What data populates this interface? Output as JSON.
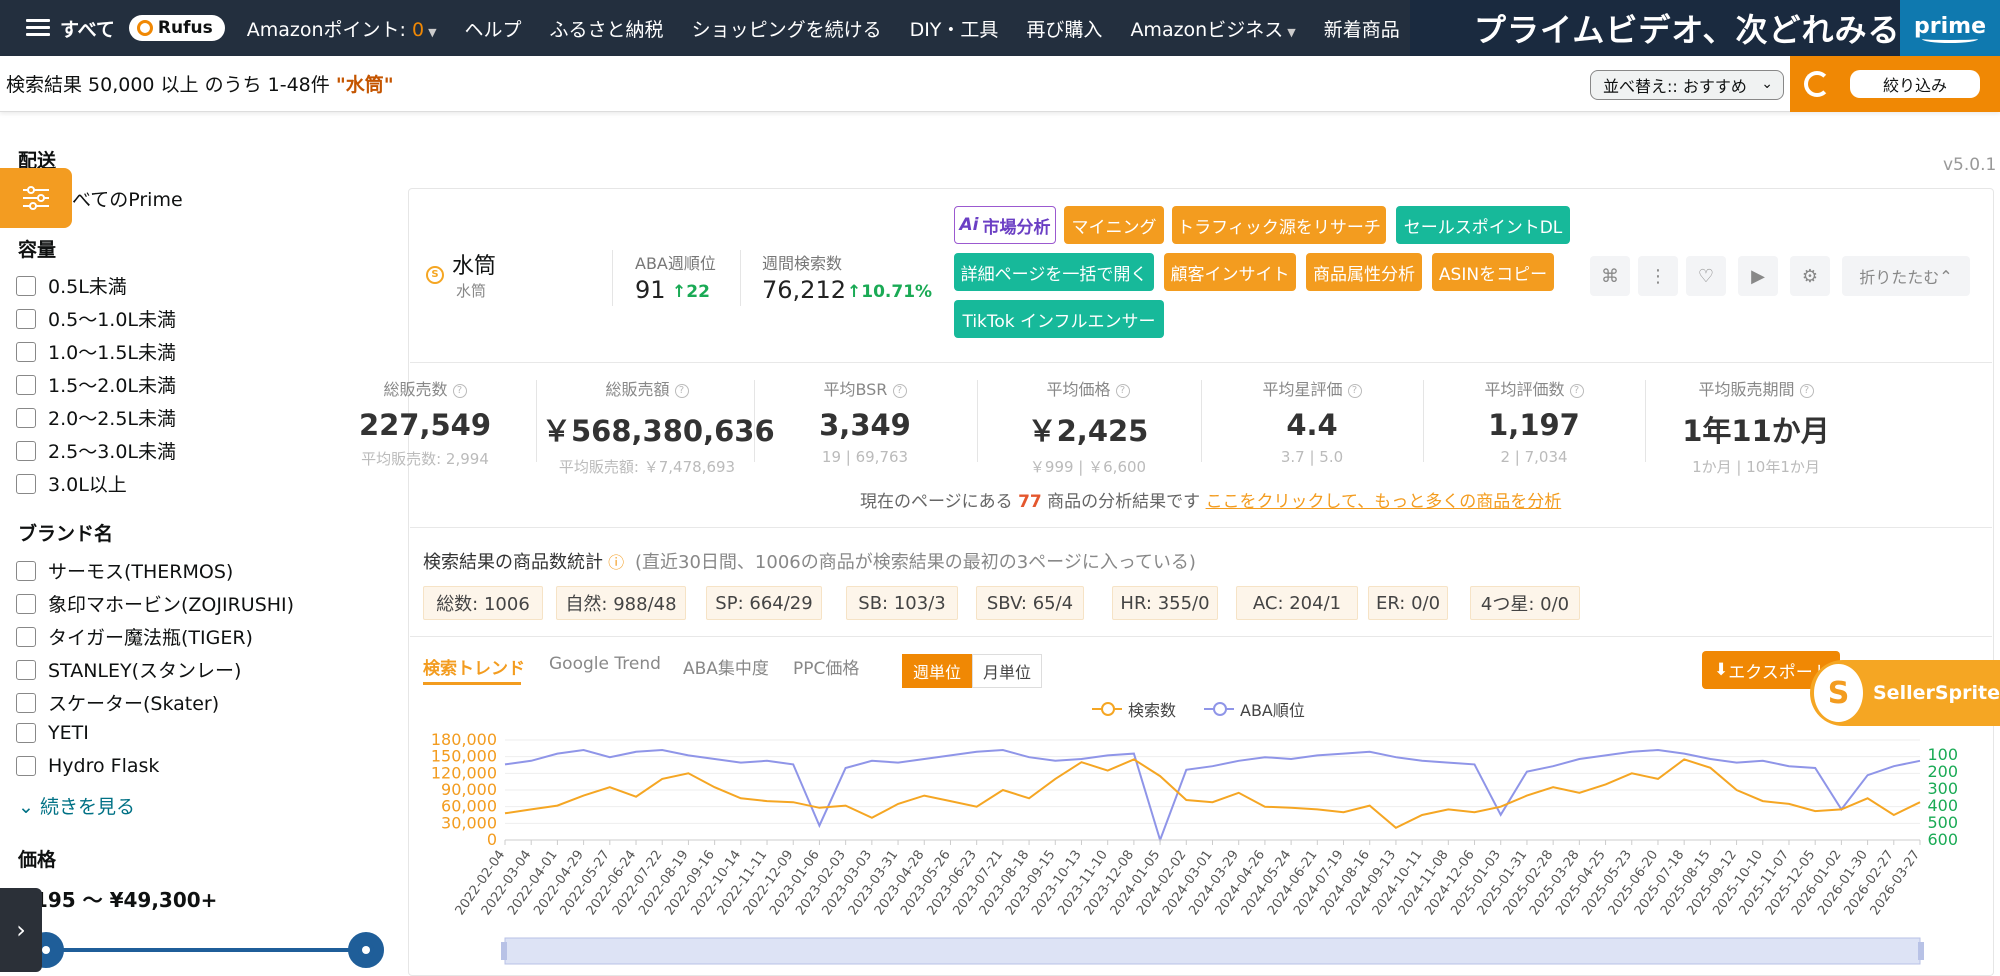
{
  "nav": {
    "all_label": "すべて",
    "rufus_label": "Rufus",
    "points_label": "Amazonポイント: ",
    "points_value": "0",
    "help": "ヘルプ",
    "furusato": "ふるさと納税",
    "continue_shopping": "ショッピングを続ける",
    "diy": "DIY・工具",
    "buy_again": "再び購入",
    "business": "Amazonビジネス",
    "new_arrivals": "新着商品",
    "banner_text": "プライムビデオ、次どれみる？",
    "banner_logo": "prime"
  },
  "results": {
    "summary": "検索結果 50,000 以上 のうち 1-48件 ",
    "query": "\"水筒\"",
    "sort_label": "並べ替え:: おすすめ",
    "filter_button": "絞り込み"
  },
  "sidebar": {
    "delivery_heading": "配送",
    "prime_label": "べてのPrime",
    "capacity_heading": "容量",
    "capacity_options": [
      "0.5L未満",
      "0.5〜1.0L未満",
      "1.0〜1.5L未満",
      "1.5〜2.0L未満",
      "2.0〜2.5L未満",
      "2.5〜3.0L未満",
      "3.0L以上"
    ],
    "brand_heading": "ブランド名",
    "brand_options": [
      "サーモス(THERMOS)",
      "象印マホービン(ZOJIRUSHI)",
      "タイガー魔法瓶(TIGER)",
      "STANLEY(スタンレー)",
      "スケーター(Skater)",
      "YETI",
      "Hydro Flask"
    ],
    "see_more": "続きを見る",
    "price_heading": "価格",
    "price_range": "¥195 〜 ¥49,300+"
  },
  "panel": {
    "version": "v5.0.1",
    "keyword": "水筒",
    "keyword_sub": "水筒",
    "aba_rank_label": "ABA週順位",
    "aba_rank_value": "91",
    "aba_rank_change": "↑22",
    "weekly_search_label": "週間検索数",
    "weekly_search_value": "76,212",
    "weekly_search_change": "↑10.71%",
    "buttons": {
      "ai_market": "市場分析",
      "mining": "マイニング",
      "traffic": "トラフィック源をリサーチ",
      "selling_points": "セールスポイントDL",
      "open_details": "詳細ページを一括で開く",
      "insight": "顧客インサイト",
      "attributes": "商品属性分析",
      "copy_asin": "ASINをコピー",
      "tiktok": "TikTok インフルエンサー",
      "collapse": "折りたたむ"
    },
    "metrics": [
      {
        "label": "総販売数",
        "value": "227,549",
        "sub": "平均販売数: 2,994"
      },
      {
        "label": "総販売額",
        "value": "￥568,380,636",
        "sub": "平均販売額: ￥7,478,693"
      },
      {
        "label": "平均BSR",
        "value": "3,349",
        "sub": "19 | 69,763"
      },
      {
        "label": "平均価格",
        "value": "￥2,425",
        "sub": "￥999 | ￥6,600"
      },
      {
        "label": "平均星評価",
        "value": "4.4",
        "sub": "3.7 | 5.0"
      },
      {
        "label": "平均評価数",
        "value": "1,197",
        "sub": "2 | 7,034"
      },
      {
        "label": "平均販売期間",
        "value": "1年11か月",
        "sub": "1か月 | 10年1か月"
      }
    ],
    "analysis_prefix": "現在のページにある ",
    "analysis_count": "77",
    "analysis_suffix": " 商品の分析結果です ",
    "analysis_link": "ここをクリックして、もっと多くの商品を分析",
    "count_title": "検索結果の商品数統計",
    "count_note": "(直近30日間、1006の商品が検索結果の最初の3ページに入っている)",
    "chips": [
      "総数: 1006",
      "自然: 988/48",
      "SP: 664/29",
      "SB: 103/3",
      "SBV: 65/4",
      "HR: 355/0",
      "AC: 204/1",
      "ER: 0/0",
      "4つ星: 0/0"
    ],
    "tabs": [
      "検索トレンド",
      "Google Trend",
      "ABA集中度",
      "PPC価格"
    ],
    "weekly": "週単位",
    "monthly": "月単位",
    "export": "エクスポート",
    "sellersprite": "SellerSprite"
  },
  "chart_data": {
    "type": "line",
    "title": "",
    "legend": [
      "検索数",
      "ABA順位"
    ],
    "legend_placement": "top-center",
    "colors": {
      "search": "#f5a623",
      "rank": "#8f95e8"
    },
    "y_left_ticks": [
      "180,000",
      "150,000",
      "120,000",
      "90,000",
      "60,000",
      "30,000",
      "0"
    ],
    "y_left_range": [
      0,
      180000
    ],
    "y_right_ticks": [
      "100",
      "200",
      "300",
      "400",
      "500",
      "600"
    ],
    "y_right_range": [
      100,
      600
    ],
    "x_ticks": [
      "2022-02-04",
      "2022-03-04",
      "2022-04-01",
      "2022-04-29",
      "2022-05-27",
      "2022-06-24",
      "2022-07-22",
      "2022-08-19",
      "2022-09-16",
      "2022-10-14",
      "2022-11-11",
      "2022-12-09",
      "2023-01-06",
      "2023-02-03",
      "2023-03-03",
      "2023-03-31",
      "2023-04-28",
      "2023-05-26",
      "2023-06-23",
      "2023-07-21",
      "2023-08-18",
      "2023-09-15",
      "2023-10-13",
      "2023-11-10",
      "2023-12-08",
      "2024-01-05",
      "2024-02-02",
      "2024-03-01",
      "2024-03-29",
      "2024-04-26",
      "2024-05-24",
      "2024-06-21",
      "2024-07-19",
      "2024-08-16",
      "2024-09-13",
      "2024-10-11",
      "2024-11-08",
      "2024-12-06",
      "2025-01-03",
      "2025-01-31",
      "2025-02-28",
      "2025-03-28",
      "2025-04-25",
      "2025-05-23",
      "2025-06-20",
      "2025-07-18",
      "2025-08-15",
      "2025-09-12",
      "2025-10-10",
      "2025-11-07",
      "2025-12-05",
      "2026-01-02",
      "2026-01-30",
      "2026-02-27",
      "2026-03-27"
    ],
    "search_volume": [
      48000,
      55000,
      62000,
      80000,
      95000,
      78000,
      110000,
      120000,
      95000,
      75000,
      70000,
      68000,
      58000,
      62000,
      40000,
      65000,
      80000,
      70000,
      60000,
      90000,
      75000,
      110000,
      140000,
      125000,
      145000,
      115000,
      72000,
      68000,
      85000,
      60000,
      58000,
      55000,
      50000,
      62000,
      22000,
      45000,
      55000,
      50000,
      60000,
      80000,
      95000,
      85000,
      100000,
      120000,
      110000,
      145000,
      130000,
      90000,
      70000,
      65000,
      52000,
      55000,
      75000,
      45000,
      68000
    ],
    "aba_rank": [
      180,
      160,
      120,
      100,
      140,
      110,
      100,
      130,
      150,
      170,
      160,
      180,
      520,
      200,
      160,
      170,
      150,
      130,
      110,
      100,
      140,
      160,
      150,
      130,
      120,
      610,
      210,
      190,
      160,
      140,
      150,
      130,
      120,
      110,
      140,
      160,
      170,
      180,
      460,
      220,
      190,
      150,
      130,
      110,
      100,
      120,
      150,
      170,
      160,
      190,
      200,
      430,
      240,
      190,
      160
    ]
  }
}
